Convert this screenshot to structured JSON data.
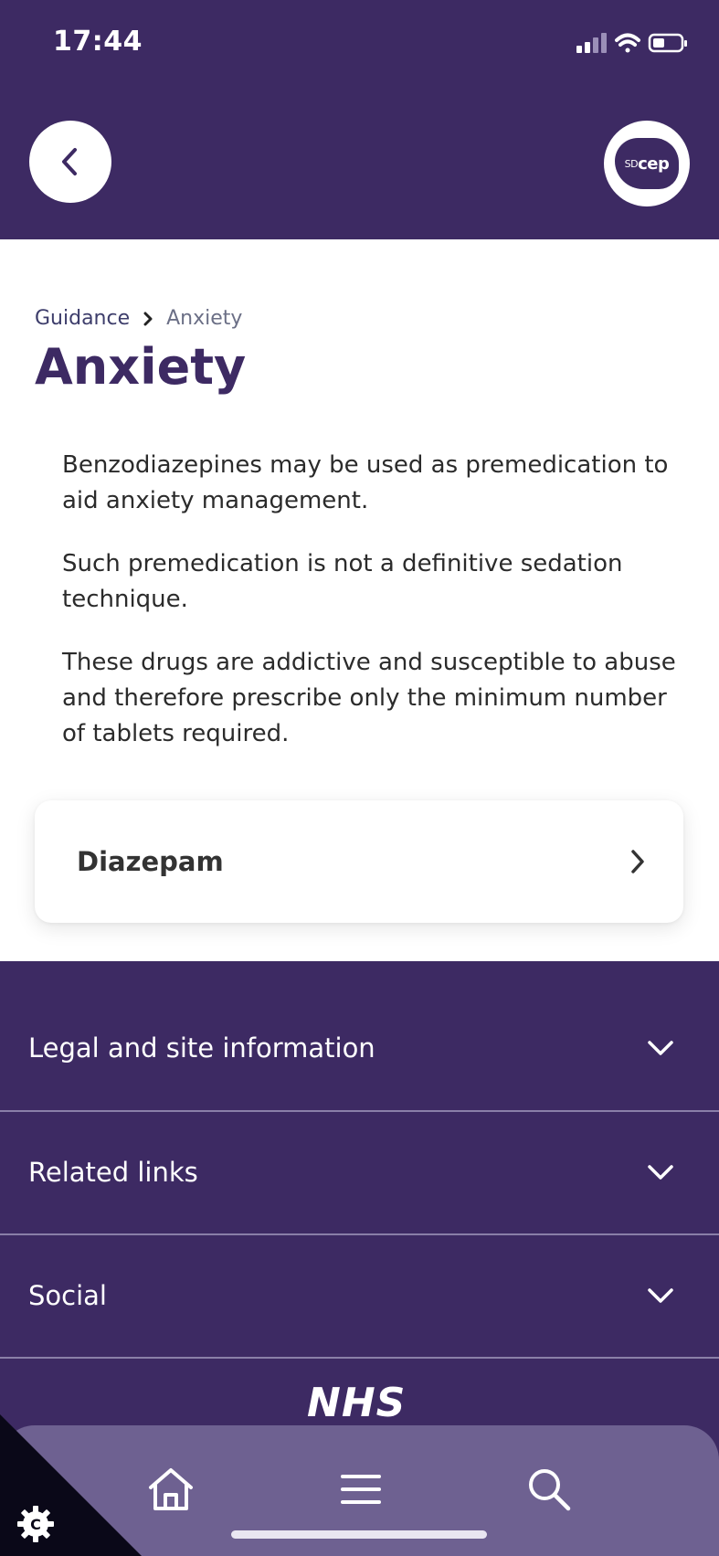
{
  "status_bar": {
    "time": "17:44"
  },
  "header": {
    "back_icon": "chevron-left-icon",
    "logo": {
      "prefix": "SD",
      "suffix": "cep"
    }
  },
  "breadcrumb": {
    "parent": "Guidance",
    "current": "Anxiety"
  },
  "page": {
    "title": "Anxiety",
    "paragraphs": [
      "Benzodiazepines may be used as premedication to aid anxiety management.",
      "Such premedication is not a definitive sedation technique.",
      "These drugs are addictive and susceptible to abuse and therefore prescribe only the minimum number of tablets required."
    ]
  },
  "card": {
    "label": "Diazepam"
  },
  "footer": {
    "sections": [
      {
        "label": "Legal and site information"
      },
      {
        "label": "Related links"
      },
      {
        "label": "Social"
      }
    ],
    "nhs_logo": "NHS"
  },
  "colors": {
    "brand_purple": "#3d2a63",
    "tabbar": "#6e6191"
  }
}
